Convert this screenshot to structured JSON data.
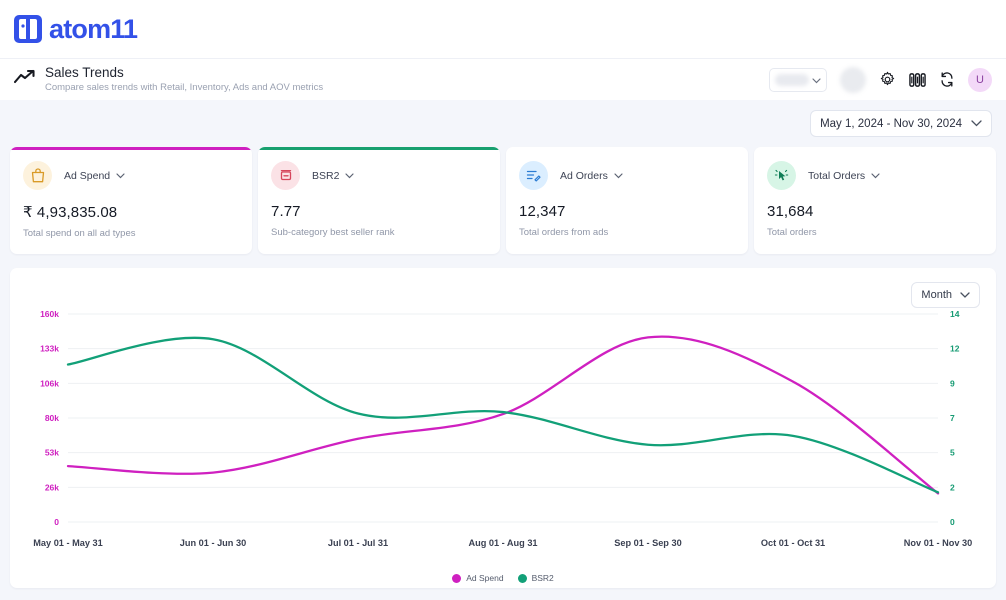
{
  "brand": {
    "name": "atom11",
    "logo_icon": "atom11-logo-icon",
    "color": "#3351e8"
  },
  "header": {
    "icon": "trend-up-icon",
    "title": "Sales Trends",
    "subtitle": "Compare sales trends with Retail, Inventory, Ads and AOV metrics",
    "tools": [
      {
        "name": "blurred-select",
        "icon": "chevron-down-icon"
      },
      {
        "name": "blurred-avatar",
        "icon": "circle-icon"
      },
      {
        "name": "settings-button",
        "icon": "gear-icon"
      },
      {
        "name": "reports-button",
        "icon": "bar-chart-icon"
      },
      {
        "name": "refresh-button",
        "icon": "refresh-icon"
      },
      {
        "name": "user-avatar",
        "icon": "avatar",
        "initial": "U"
      }
    ]
  },
  "date_range": {
    "label": "May 1, 2024 - Nov 30, 2024",
    "icon": "chevron-down-icon"
  },
  "cards": [
    {
      "name": "Ad Spend",
      "value": "₹ 4,93,835.08",
      "description": "Total spend on all ad types",
      "accent": "#cf20c0",
      "icon": "shopping-bag-icon",
      "icon_bg": "#fdf2dd",
      "icon_color": "#d99a27",
      "dropdown_icon": "chevron-down-icon"
    },
    {
      "name": "BSR2",
      "value": "7.77",
      "description": "Sub-category best seller rank",
      "accent": "#18a06f",
      "icon": "trophy-rank-icon",
      "icon_bg": "#fbe2e6",
      "icon_color": "#d6455c",
      "dropdown_icon": "chevron-down-icon"
    },
    {
      "name": "Ad Orders",
      "value": "12,347",
      "description": "Total orders from ads",
      "accent": "transparent",
      "icon": "note-edit-icon",
      "icon_bg": "#dbeeff",
      "icon_color": "#2b7cd3",
      "dropdown_icon": "chevron-down-icon"
    },
    {
      "name": "Total Orders",
      "value": "31,684",
      "description": "Total orders",
      "accent": "transparent",
      "icon": "click-cursor-icon",
      "icon_bg": "#d7f5e6",
      "icon_color": "#0f7d56",
      "dropdown_icon": "chevron-down-icon"
    }
  ],
  "chart_panel": {
    "granularity": {
      "label": "Month",
      "icon": "chevron-down-icon"
    }
  },
  "chart_data": {
    "type": "line",
    "title": "",
    "xlabel": "",
    "grid": true,
    "legend_position": "bottom",
    "categories": [
      "May 01 - May 31",
      "Jun 01 - Jun 30",
      "Jul 01 - Jul 31",
      "Aug 01 - Aug 31",
      "Sep 01 - Sep 30",
      "Oct 01 - Oct 31",
      "Nov 01 - Nov 30"
    ],
    "axes": {
      "left": {
        "label": "Ad Spend",
        "color": "#cf20c0",
        "ticks": [
          0,
          26000,
          53000,
          80000,
          106000,
          133000,
          160000
        ],
        "tick_labels": [
          "0",
          "26k",
          "53k",
          "80k",
          "106k",
          "133k",
          "160k"
        ],
        "ylim": [
          0,
          160000
        ]
      },
      "right": {
        "label": "BSR2",
        "color": "#169b73",
        "ticks": [
          0,
          2,
          5,
          7,
          9,
          12,
          14
        ],
        "tick_labels": [
          "0",
          "2",
          "5",
          "7",
          "9",
          "12",
          "14"
        ],
        "ylim": [
          0,
          14
        ]
      }
    },
    "series": [
      {
        "name": "Ad Spend",
        "color": "#cf20c0",
        "axis": "left",
        "values": [
          43000,
          38000,
          64000,
          83000,
          142000,
          108000,
          22000
        ]
      },
      {
        "name": "BSR2",
        "color": "#12a078",
        "axis": "right",
        "values": [
          10.6,
          12.3,
          7.3,
          7.4,
          5.2,
          5.8,
          2.0
        ]
      }
    ],
    "legend": [
      {
        "label": "Ad Spend",
        "color": "#cf20c0"
      },
      {
        "label": "BSR2",
        "color": "#12a078"
      }
    ]
  }
}
